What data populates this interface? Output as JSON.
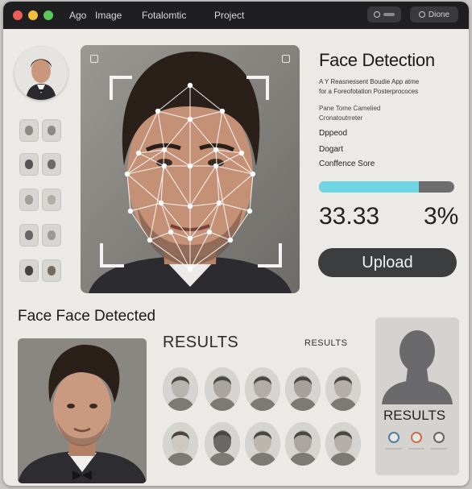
{
  "titlebar": {
    "menu": [
      "Ago",
      "Image",
      "Fotalomtic",
      "Project"
    ],
    "buttons": [
      "",
      "Dione"
    ]
  },
  "panel": {
    "title": "Face Detection",
    "subtitle_line1": "A Y Reasnessent Boudie App atme",
    "subtitle_line2": "for a Foreofotation Posterprococes",
    "meta_line1": "Pane Tome  Camelied",
    "meta_line2": "Cronatoutrreter",
    "uploaded_label": "Dppeod",
    "stage_label": "Dogart",
    "confidence_label": "Conffence Sore",
    "confidence_value": 0.74,
    "score": "33.33",
    "percent": "3%",
    "upload_button": "Upload"
  },
  "section": {
    "face_detected": "Face Face Detected",
    "results_title": "RESULTS",
    "results_small": "RESULTS",
    "silhouette_results": "RESULTS"
  },
  "colors": {
    "accent": "#6fd6e3",
    "titlebar": "#1f1f22",
    "button_dark": "#3c3d3f"
  },
  "icons": [
    "close-dot",
    "minimize-dot",
    "maximize-dot",
    "toggle-icon",
    "search-icon",
    "image-icon",
    "settings-icon"
  ]
}
